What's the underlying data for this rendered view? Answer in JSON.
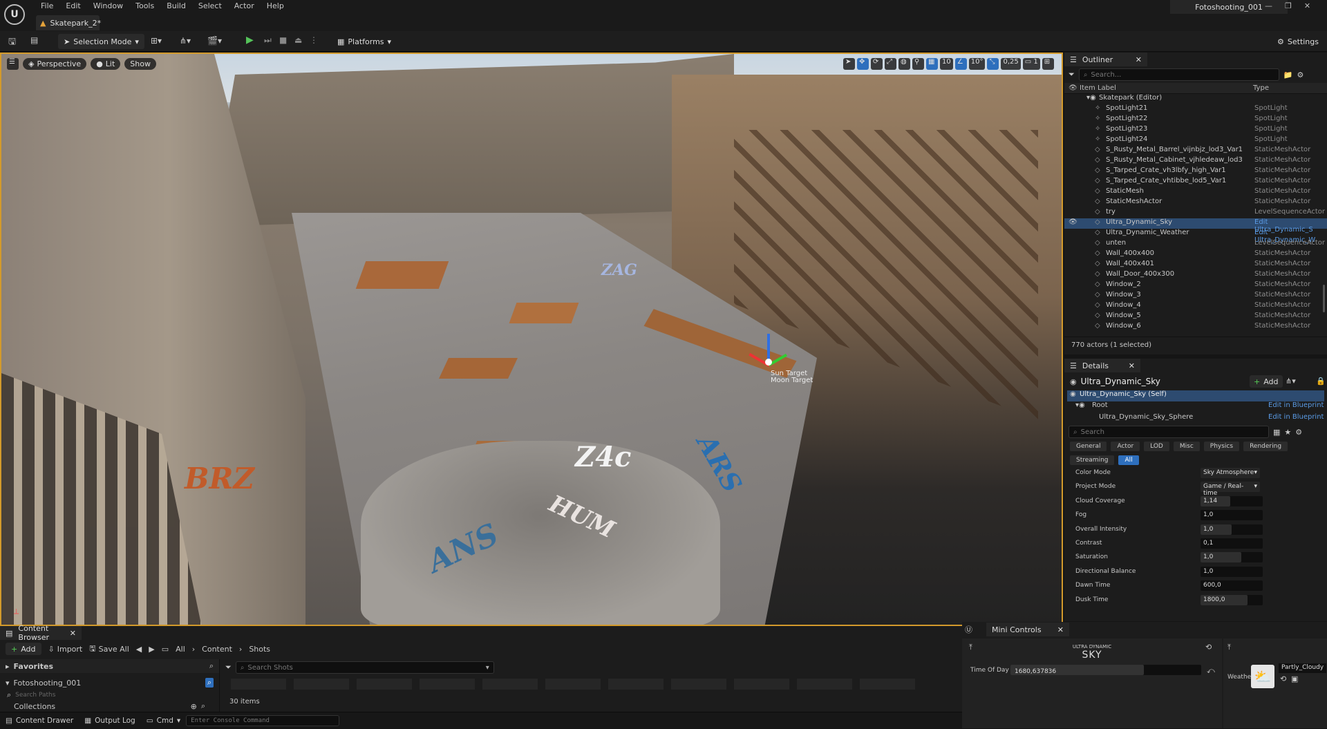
{
  "app": {
    "menu": [
      "File",
      "Edit",
      "Window",
      "Tools",
      "Build",
      "Select",
      "Actor",
      "Help"
    ],
    "project_tab": "Fotoshooting_001",
    "level_tab": "Skatepark_2*"
  },
  "toolbar": {
    "mode_label": "Selection Mode",
    "platforms_label": "Platforms",
    "settings_label": "Settings"
  },
  "viewport": {
    "perspective_label": "Perspective",
    "lit_label": "Lit",
    "show_label": "Show",
    "grid_snap": "10",
    "rotation_snap": "10°",
    "scale_snap": "0,25",
    "camera_speed": "1",
    "gizmo_label_1": "Sun Target",
    "gizmo_label_2": "Moon Target"
  },
  "outliner": {
    "tab_label": "Outliner",
    "search_placeholder": "Search...",
    "col_label": "Item Label",
    "col_type": "Type",
    "root_item": "Skatepark (Editor)",
    "items": [
      {
        "name": "SpotLight21",
        "type": "SpotLight"
      },
      {
        "name": "SpotLight22",
        "type": "SpotLight"
      },
      {
        "name": "SpotLight23",
        "type": "SpotLight"
      },
      {
        "name": "SpotLight24",
        "type": "SpotLight"
      },
      {
        "name": "S_Rusty_Metal_Barrel_vijnbjz_lod3_Var1",
        "type": "StaticMeshActor"
      },
      {
        "name": "S_Rusty_Metal_Cabinet_vjhledeaw_lod3",
        "type": "StaticMeshActor"
      },
      {
        "name": "S_Tarped_Crate_vh3lbfy_high_Var1",
        "type": "StaticMeshActor"
      },
      {
        "name": "S_Tarped_Crate_vhtibbe_lod5_Var1",
        "type": "StaticMeshActor"
      },
      {
        "name": "StaticMesh",
        "type": "StaticMeshActor"
      },
      {
        "name": "StaticMeshActor",
        "type": "StaticMeshActor"
      },
      {
        "name": "try",
        "type": "LevelSequenceActor"
      },
      {
        "name": "Ultra_Dynamic_Sky",
        "type": "Edit Ultra_Dynamic_S"
      },
      {
        "name": "Ultra_Dynamic_Weather",
        "type": "Edit Ultra_Dynamic_W"
      },
      {
        "name": "unten",
        "type": "LevelSequenceActor"
      },
      {
        "name": "Wall_400x400",
        "type": "StaticMeshActor"
      },
      {
        "name": "Wall_400x401",
        "type": "StaticMeshActor"
      },
      {
        "name": "Wall_Door_400x300",
        "type": "StaticMeshActor"
      },
      {
        "name": "Window_2",
        "type": "StaticMeshActor"
      },
      {
        "name": "Window_3",
        "type": "StaticMeshActor"
      },
      {
        "name": "Window_4",
        "type": "StaticMeshActor"
      },
      {
        "name": "Window_5",
        "type": "StaticMeshActor"
      },
      {
        "name": "Window_6",
        "type": "StaticMeshActor"
      }
    ],
    "status": "770 actors (1 selected)"
  },
  "details": {
    "tab_label": "Details",
    "actor_name": "Ultra_Dynamic_Sky",
    "add_label": "Add",
    "self_label": "Ultra_Dynamic_Sky (Self)",
    "root_label": "Root",
    "sphere_label": "Ultra_Dynamic_Sky_Sphere",
    "edit_bp": "Edit in Blueprint",
    "search_placeholder": "Search",
    "tabs": [
      "General",
      "Actor",
      "LOD",
      "Misc",
      "Physics",
      "Rendering",
      "Streaming",
      "All"
    ],
    "props": [
      {
        "label": "Color Mode",
        "value": "Sky Atmosphere",
        "kind": "dropdown"
      },
      {
        "label": "Project Mode",
        "value": "Game / Real-time",
        "kind": "dropdown"
      },
      {
        "label": "Cloud Coverage",
        "value": "1,14",
        "fill": 0.48
      },
      {
        "label": "Fog",
        "value": "1,0",
        "fill": 0.0
      },
      {
        "label": "Overall Intensity",
        "value": "1,0",
        "fill": 0.5
      },
      {
        "label": "Contrast",
        "value": "0,1",
        "fill": 0.0
      },
      {
        "label": "Saturation",
        "value": "1,0",
        "fill": 0.65
      },
      {
        "label": "Directional Balance",
        "value": "1,0",
        "fill": 0.0
      },
      {
        "label": "Dawn Time",
        "value": "600,0",
        "fill": 0.0
      },
      {
        "label": "Dusk Time",
        "value": "1800,0",
        "fill": 0.75
      }
    ]
  },
  "content_browser": {
    "tab_label": "Content Browser",
    "add_label": "Add",
    "import_label": "Import",
    "save_all_label": "Save All",
    "path": [
      "All",
      "Content",
      "Shots"
    ],
    "favorites_label": "Favorites",
    "folder_label": "Fotoshooting_001",
    "search_paths_placeholder": "Search Paths",
    "collections_label": "Collections",
    "search_placeholder": "Search Shots",
    "item_count": "30 items"
  },
  "statusbar": {
    "content_drawer": "Content Drawer",
    "output_log": "Output Log",
    "cmd_label": "Cmd",
    "console_placeholder": "Enter Console Command"
  },
  "mini_controls": {
    "tab_label": "Mini Controls",
    "brand_top": "ULTRA DYNAMIC",
    "brand_main": "SKY",
    "time_label": "Time Of Day",
    "time_value": "1680,637836",
    "time_fill": 0.7,
    "weather_label": "Weather",
    "weather_value": "Partly_Cloudy"
  }
}
